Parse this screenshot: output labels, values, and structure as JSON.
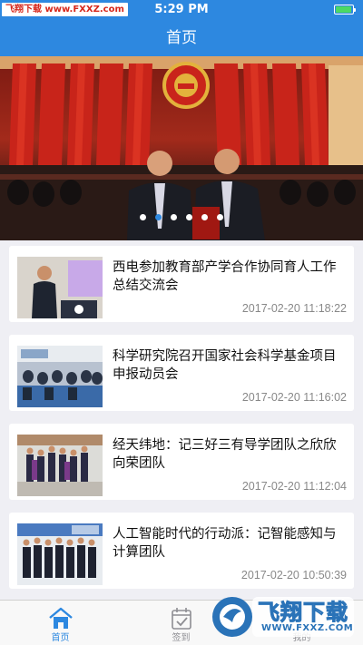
{
  "status_bar": {
    "watermark": "飞翔下载 www.FXXZ.com",
    "time": "5:29 PM"
  },
  "nav": {
    "title": "首页"
  },
  "banner": {
    "slide_count": 6,
    "active_slide": 2
  },
  "news": [
    {
      "title": "西电参加教育部产学合作协同育人工作总结交流会",
      "date": "2017-02-20 11:18:22"
    },
    {
      "title": "科学研究院召开国家社会科学基金项目申报动员会",
      "date": "2017-02-20 11:16:02"
    },
    {
      "title": "经天纬地：记三好三有导学团队之欣欣向荣团队",
      "date": "2017-02-20 11:12:04"
    },
    {
      "title": "人工智能时代的行动派：记智能感知与计算团队",
      "date": "2017-02-20 10:50:39"
    }
  ],
  "tabs": [
    {
      "label": "首页",
      "icon": "home-icon",
      "active": true
    },
    {
      "label": "签到",
      "icon": "checkin-icon",
      "active": false
    },
    {
      "label": "我的",
      "icon": "profile-icon",
      "active": false
    }
  ],
  "watermark_logo": {
    "name": "飞翔下载",
    "url": "WWW.FXXZ.COM"
  },
  "colors": {
    "primary": "#2d88e0",
    "background": "#efeff4",
    "date_text": "#888888",
    "tab_inactive": "#8e8e93"
  }
}
